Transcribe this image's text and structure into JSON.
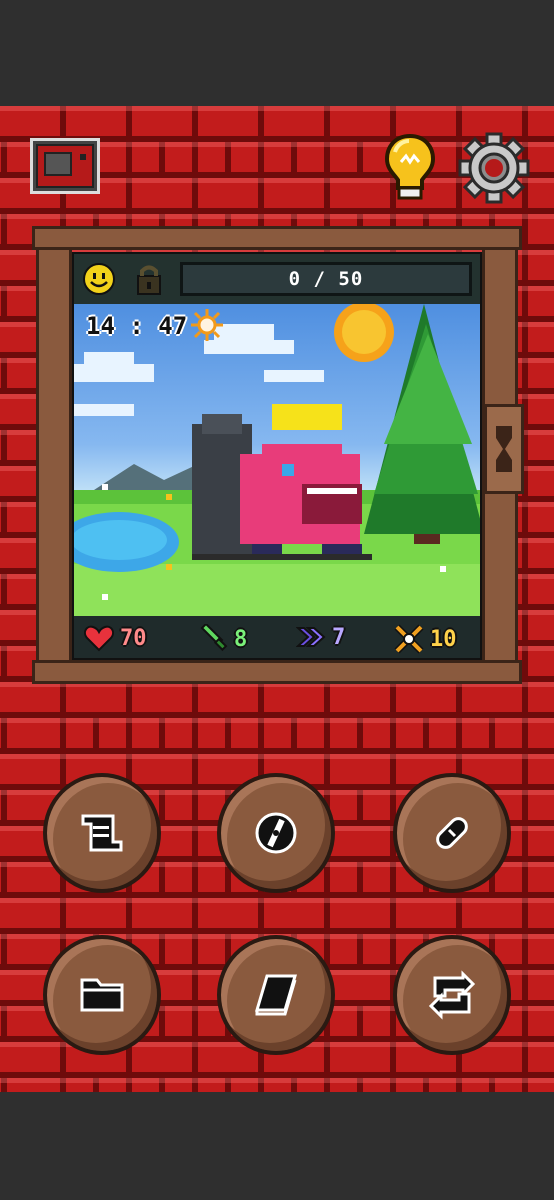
{
  "header": {
    "tv_icon": "tv-icon",
    "hint_icon": "lightbulb-icon",
    "settings_icon": "gear-icon"
  },
  "status": {
    "mood_icon": "happy-face-icon",
    "lock_icon": "lock-icon",
    "progress_text": "0 / 50",
    "progress_value": 0,
    "progress_max": 50
  },
  "scene": {
    "time": "14 : 47",
    "weather_icon": "sun-icon"
  },
  "stats": {
    "health": "70",
    "attack": "8",
    "speed": "7",
    "power": "10"
  },
  "actions": [
    {
      "icon": "scroll-icon"
    },
    {
      "icon": "compass-icon"
    },
    {
      "icon": "pill-icon"
    },
    {
      "icon": "folder-icon"
    },
    {
      "icon": "book-icon"
    },
    {
      "icon": "swap-icon"
    }
  ],
  "colors": {
    "brick": "#c21c1c",
    "mortar": "#6e0b0b",
    "wood": "#8a5a3e",
    "health": "#e8323c",
    "attack": "#3fb44a",
    "speed": "#6a4fe0",
    "power": "#f0a020"
  }
}
